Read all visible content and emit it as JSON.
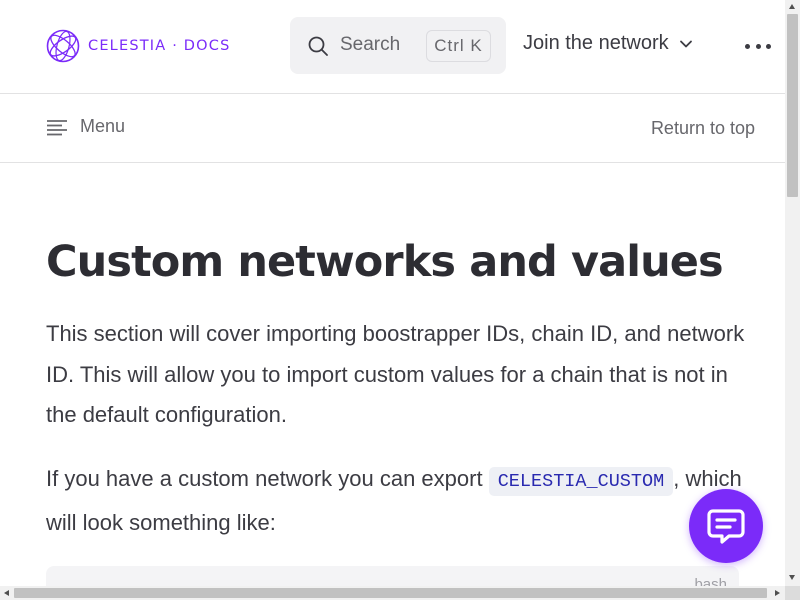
{
  "header": {
    "logo_text": "CELESTIA · DOCS",
    "logo_icon": "celestia-globe-icon",
    "search": {
      "label": "Search",
      "shortcut": "Ctrl K",
      "icon": "search-icon"
    },
    "nav_dropdown": {
      "label": "Join the network",
      "icon": "chevron-down-icon"
    },
    "more_icon": "more-horizontal-icon"
  },
  "local_nav": {
    "menu_label": "Menu",
    "menu_icon": "menu-lines-icon",
    "return_label": "Return to top"
  },
  "article": {
    "title": "Custom networks and values",
    "paragraph1": "This section will cover importing boostrapper IDs, chain ID, and network ID. This will allow you to import custom values for a chain that is not in the default configuration.",
    "paragraph2_before": "If you have a custom network you can export ",
    "paragraph2_code": "CELESTIA_CUSTOM",
    "paragraph2_after": ", which will look something like:",
    "code_block_lang": "bash"
  },
  "chat_button": {
    "icon": "chat-bubble-icon"
  },
  "colors": {
    "brand": "#7b2bf9",
    "text": "#3c3c43",
    "muted": "#67676c",
    "code_text": "#2a2ab0"
  }
}
